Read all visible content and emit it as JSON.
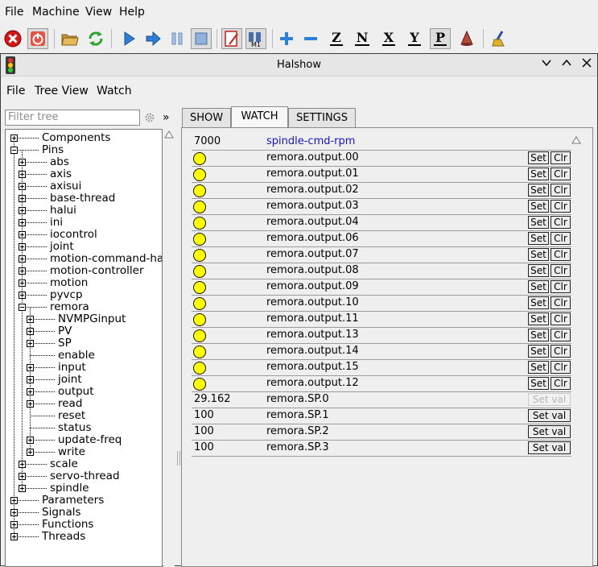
{
  "menubar": {
    "file": "File",
    "machine": "Machine",
    "view": "View",
    "help": "Help"
  },
  "toolbar": {
    "axes": [
      "Z",
      "N",
      "X",
      "Y",
      "P"
    ],
    "m1": "M1"
  },
  "window": {
    "title": "Halshow"
  },
  "halmenu": {
    "file": "File",
    "tree_view": "Tree View",
    "watch": "Watch"
  },
  "tree": {
    "filter_placeholder": "Filter tree",
    "more": "»",
    "items": [
      {
        "label": "Components",
        "expander": "plus"
      },
      {
        "label": "Pins",
        "expander": "minus"
      },
      {
        "label": "abs",
        "expander": "plus"
      },
      {
        "label": "axis",
        "expander": "plus"
      },
      {
        "label": "axisui",
        "expander": "plus"
      },
      {
        "label": "base-thread",
        "expander": "plus"
      },
      {
        "label": "halui",
        "expander": "plus"
      },
      {
        "label": "ini",
        "expander": "plus"
      },
      {
        "label": "iocontrol",
        "expander": "plus"
      },
      {
        "label": "joint",
        "expander": "plus"
      },
      {
        "label": "motion-command-han",
        "expander": "plus"
      },
      {
        "label": "motion-controller",
        "expander": "plus"
      },
      {
        "label": "motion",
        "expander": "plus"
      },
      {
        "label": "pyvcp",
        "expander": "plus"
      },
      {
        "label": "remora",
        "expander": "minus"
      },
      {
        "label": "NVMPGinput",
        "expander": "plus"
      },
      {
        "label": "PV",
        "expander": "plus"
      },
      {
        "label": "SP",
        "expander": "plus"
      },
      {
        "label": "enable",
        "expander": ""
      },
      {
        "label": "input",
        "expander": "plus"
      },
      {
        "label": "joint",
        "expander": "plus"
      },
      {
        "label": "output",
        "expander": "plus"
      },
      {
        "label": "read",
        "expander": "plus"
      },
      {
        "label": "reset",
        "expander": ""
      },
      {
        "label": "status",
        "expander": ""
      },
      {
        "label": "update-freq",
        "expander": "plus"
      },
      {
        "label": "write",
        "expander": "plus"
      },
      {
        "label": "scale",
        "expander": "plus"
      },
      {
        "label": "servo-thread",
        "expander": "plus"
      },
      {
        "label": "spindle",
        "expander": "plus"
      },
      {
        "label": "Parameters",
        "expander": "plus"
      },
      {
        "label": "Signals",
        "expander": "plus"
      },
      {
        "label": "Functions",
        "expander": "plus"
      },
      {
        "label": "Threads",
        "expander": "plus"
      }
    ]
  },
  "tabs": {
    "show": "SHOW",
    "watch": "WATCH",
    "settings": "SETTINGS"
  },
  "watch": {
    "set_label": "Set",
    "clr_label": "Clr",
    "set_val_label": "Set val",
    "led_color": "#ffff00",
    "link_color": "#1515c8",
    "rows": [
      {
        "kind": "value",
        "value": "7000",
        "name": "spindle-cmd-rpm",
        "controls": "none",
        "highlight": true
      },
      {
        "kind": "bit",
        "name": "remora.output.00",
        "controls": "setclr"
      },
      {
        "kind": "bit",
        "name": "remora.output.01",
        "controls": "setclr"
      },
      {
        "kind": "bit",
        "name": "remora.output.02",
        "controls": "setclr"
      },
      {
        "kind": "bit",
        "name": "remora.output.03",
        "controls": "setclr"
      },
      {
        "kind": "bit",
        "name": "remora.output.04",
        "controls": "setclr"
      },
      {
        "kind": "bit",
        "name": "remora.output.06",
        "controls": "setclr"
      },
      {
        "kind": "bit",
        "name": "remora.output.07",
        "controls": "setclr"
      },
      {
        "kind": "bit",
        "name": "remora.output.08",
        "controls": "setclr"
      },
      {
        "kind": "bit",
        "name": "remora.output.09",
        "controls": "setclr"
      },
      {
        "kind": "bit",
        "name": "remora.output.10",
        "controls": "setclr"
      },
      {
        "kind": "bit",
        "name": "remora.output.11",
        "controls": "setclr"
      },
      {
        "kind": "bit",
        "name": "remora.output.13",
        "controls": "setclr"
      },
      {
        "kind": "bit",
        "name": "remora.output.14",
        "controls": "setclr"
      },
      {
        "kind": "bit",
        "name": "remora.output.15",
        "controls": "setclr"
      },
      {
        "kind": "bit",
        "name": "remora.output.12",
        "controls": "setclr"
      },
      {
        "kind": "value",
        "value": "29.162",
        "name": "remora.SP.0",
        "controls": "setval-disabled"
      },
      {
        "kind": "value",
        "value": "100",
        "name": "remora.SP.1",
        "controls": "setval"
      },
      {
        "kind": "value",
        "value": "100",
        "name": "remora.SP.2",
        "controls": "setval"
      },
      {
        "kind": "value",
        "value": "100",
        "name": "remora.SP.3",
        "controls": "setval"
      }
    ]
  }
}
